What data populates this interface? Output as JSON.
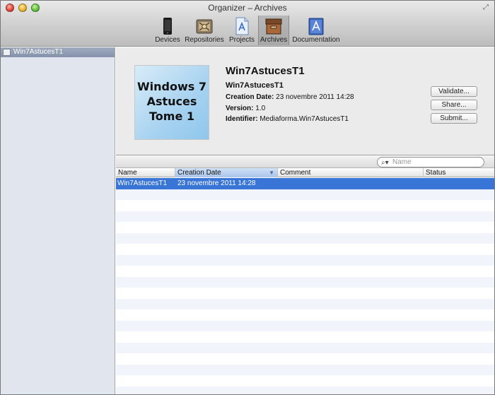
{
  "window": {
    "title": "Organizer – Archives"
  },
  "toolbar": {
    "items": [
      {
        "label": "Devices",
        "icon": "iphone-icon"
      },
      {
        "label": "Repositories",
        "icon": "repository-icon"
      },
      {
        "label": "Projects",
        "icon": "project-document-icon"
      },
      {
        "label": "Archives",
        "icon": "archive-box-icon",
        "selected": true
      },
      {
        "label": "Documentation",
        "icon": "documentation-icon"
      }
    ]
  },
  "sidebar": {
    "items": [
      {
        "label": "Win7AstucesT1",
        "selected": true
      }
    ]
  },
  "detail": {
    "thumbnail_text": [
      "Windows 7",
      "Astuces",
      "Tome 1"
    ],
    "app_title": "Win7AstucesT1",
    "subtitle": "Win7AstucesT1",
    "creation_label": "Creation Date:",
    "creation_value": "23 novembre 2011 14:28",
    "version_label": "Version:",
    "version_value": "1.0",
    "identifier_label": "Identifier:",
    "identifier_value": "Mediaforma.Win7AstucesT1",
    "buttons": {
      "validate": "Validate...",
      "share": "Share...",
      "submit": "Submit..."
    }
  },
  "search": {
    "placeholder": "Name"
  },
  "table": {
    "columns": [
      "Name",
      "Creation Date",
      "Comment",
      "Status"
    ],
    "sorted_column": "Creation Date",
    "rows": [
      {
        "name": "Win7AstucesT1",
        "creation_date": "23 novembre 2011 14:28",
        "comment": "",
        "status": "",
        "selected": true
      }
    ]
  },
  "colors": {
    "selection": "#3875d7",
    "sidebar_background": "#e0e5ee",
    "sidebar_selection": "#8492ab"
  }
}
